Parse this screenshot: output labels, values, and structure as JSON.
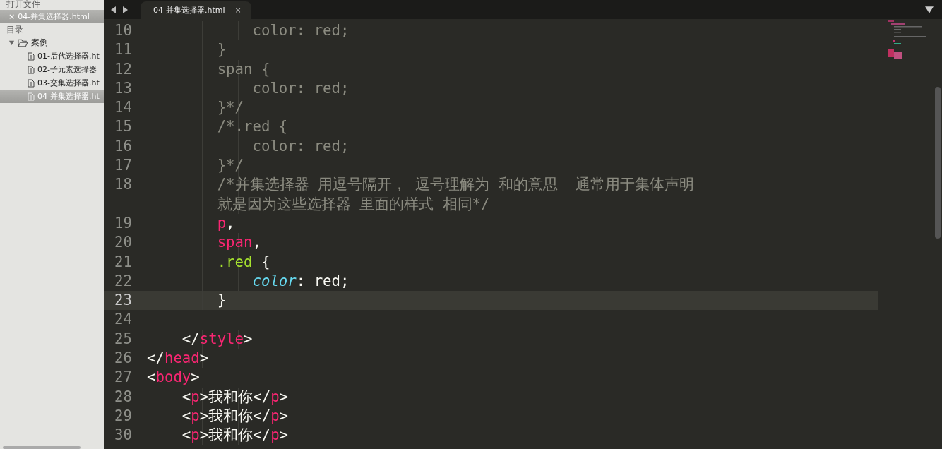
{
  "sidebar": {
    "open_files_heading": "打开文件",
    "open_files": [
      {
        "label": "04-并集选择器.html",
        "close": "×",
        "selected": true
      }
    ],
    "folders_heading": "目录",
    "folder": {
      "label": "案例",
      "expanded": true,
      "children": [
        {
          "label": "01-后代选择器.ht",
          "selected": false
        },
        {
          "label": "02-子元素选择器",
          "selected": false
        },
        {
          "label": "03-交集选择器.ht",
          "selected": false
        },
        {
          "label": "04-并集选择器.ht",
          "selected": true
        }
      ]
    }
  },
  "tabs": [
    {
      "label": "04-并集选择器.html",
      "close": "×",
      "selected": true
    }
  ],
  "editor": {
    "lines": [
      {
        "number": "10",
        "current": false,
        "tokens": [
          {
            "text": "            color: red;",
            "kind": "comment"
          }
        ]
      },
      {
        "number": "11",
        "current": false,
        "tokens": [
          {
            "text": "        }",
            "kind": "comment"
          }
        ]
      },
      {
        "number": "12",
        "current": false,
        "tokens": [
          {
            "text": "        span {",
            "kind": "comment"
          }
        ]
      },
      {
        "number": "13",
        "current": false,
        "tokens": [
          {
            "text": "            color: red;",
            "kind": "comment"
          }
        ]
      },
      {
        "number": "14",
        "current": false,
        "tokens": [
          {
            "text": "        }*/",
            "kind": "comment"
          }
        ]
      },
      {
        "number": "15",
        "current": false,
        "tokens": [
          {
            "text": "        /*.red {",
            "kind": "comment"
          }
        ]
      },
      {
        "number": "16",
        "current": false,
        "tokens": [
          {
            "text": "            color: red;",
            "kind": "comment"
          }
        ]
      },
      {
        "number": "17",
        "current": false,
        "tokens": [
          {
            "text": "        }*/",
            "kind": "comment"
          }
        ]
      },
      {
        "number": "18",
        "current": false,
        "tokens": [
          {
            "text": "        /*并集选择器 用逗号隔开， 逗号理解为 和的意思  通常用于集体声明",
            "kind": "comment"
          },
          {
            "text": "就是因为这些选择器 里面的样式 相同*/",
            "kind": "comment",
            "wrapped": true
          }
        ]
      },
      {
        "number": "19",
        "current": false,
        "tokens": [
          {
            "text": "        p",
            "kind": "tag"
          },
          {
            "text": ",",
            "kind": "plain"
          }
        ]
      },
      {
        "number": "20",
        "current": false,
        "tokens": [
          {
            "text": "        span",
            "kind": "tag"
          },
          {
            "text": ",",
            "kind": "plain"
          }
        ]
      },
      {
        "number": "21",
        "current": false,
        "tokens": [
          {
            "text": "        .red",
            "kind": "class"
          },
          {
            "text": " {",
            "kind": "plain"
          }
        ]
      },
      {
        "number": "22",
        "current": false,
        "tokens": [
          {
            "text": "            color",
            "kind": "property"
          },
          {
            "text": ": red;",
            "kind": "plain"
          }
        ]
      },
      {
        "number": "23",
        "current": true,
        "tokens": [
          {
            "text": "        }",
            "kind": "plain"
          }
        ]
      },
      {
        "number": "24",
        "current": false
      },
      {
        "number": "25",
        "current": false,
        "tokens": [
          {
            "text": "    </",
            "kind": "plain"
          },
          {
            "text": "style",
            "kind": "tag"
          },
          {
            "text": ">",
            "kind": "plain"
          }
        ]
      },
      {
        "number": "26",
        "current": false,
        "tokens": [
          {
            "text": "</",
            "kind": "plain"
          },
          {
            "text": "head",
            "kind": "tag"
          },
          {
            "text": ">",
            "kind": "plain"
          }
        ]
      },
      {
        "number": "27",
        "current": false,
        "tokens": [
          {
            "text": "<",
            "kind": "plain"
          },
          {
            "text": "body",
            "kind": "tag"
          },
          {
            "text": ">",
            "kind": "plain"
          }
        ]
      },
      {
        "number": "28",
        "current": false,
        "tokens": [
          {
            "text": "    <",
            "kind": "plain"
          },
          {
            "text": "p",
            "kind": "tag"
          },
          {
            "text": ">我和你</",
            "kind": "plain"
          },
          {
            "text": "p",
            "kind": "tag"
          },
          {
            "text": ">",
            "kind": "plain"
          }
        ]
      },
      {
        "number": "29",
        "current": false,
        "tokens": [
          {
            "text": "    <",
            "kind": "plain"
          },
          {
            "text": "p",
            "kind": "tag"
          },
          {
            "text": ">我和你</",
            "kind": "plain"
          },
          {
            "text": "p",
            "kind": "tag"
          },
          {
            "text": ">",
            "kind": "plain"
          }
        ]
      },
      {
        "number": "30",
        "current": false,
        "tokens": [
          {
            "text": "    <",
            "kind": "plain"
          },
          {
            "text": "p",
            "kind": "tag"
          },
          {
            "text": ">我和你</",
            "kind": "plain"
          },
          {
            "text": "p",
            "kind": "tag"
          },
          {
            "text": ">",
            "kind": "plain"
          }
        ]
      }
    ]
  }
}
